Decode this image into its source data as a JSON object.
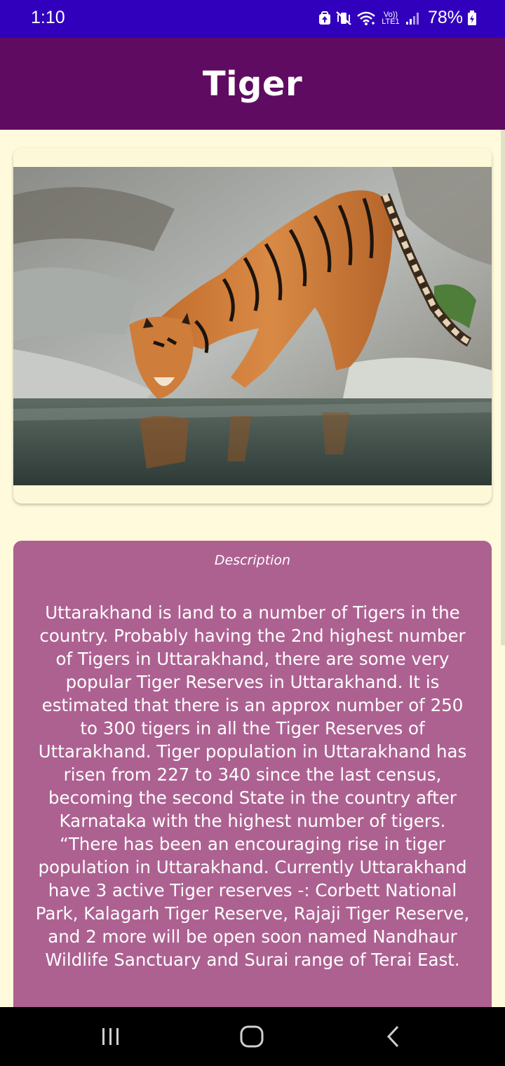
{
  "status_bar": {
    "time": "1:10",
    "lte": "Vo)) LTE1",
    "battery": "78%"
  },
  "app_bar": {
    "title": "Tiger"
  },
  "image_card": {
    "image_description_icon": "tiger-photo"
  },
  "description": {
    "heading": "Description",
    "text": "Uttarakhand is land to a number of Tigers in the country. Probably having the 2nd highest number of Tigers in Uttarakhand, there are some very popular Tiger Reserves in Uttarakhand. It is estimated that there is an approx number of 250 to 300 tigers in all the Tiger Reserves of Uttarakhand. Tiger population in Uttarakhand has risen from 227 to 340 since the last census, becoming the second State in the country after Karnataka with the highest number of tigers. “There has been an encouraging rise in tiger population in Uttarakhand. Currently Uttarakhand have 3 active Tiger reserves -: Corbett National Park, Kalagarh Tiger Reserve, Rajaji Tiger Reserve, and 2 more will be open soon named Nandhaur Wildlife Sanctuary and Surai range of Terai East."
  },
  "nav_bar": {
    "icons": [
      "recent-apps-icon",
      "home-icon",
      "back-icon"
    ]
  },
  "colors": {
    "status_bar": "#3100bd",
    "app_bar": "#600b62",
    "background": "#fffadc",
    "description_card": "#ad6191"
  }
}
